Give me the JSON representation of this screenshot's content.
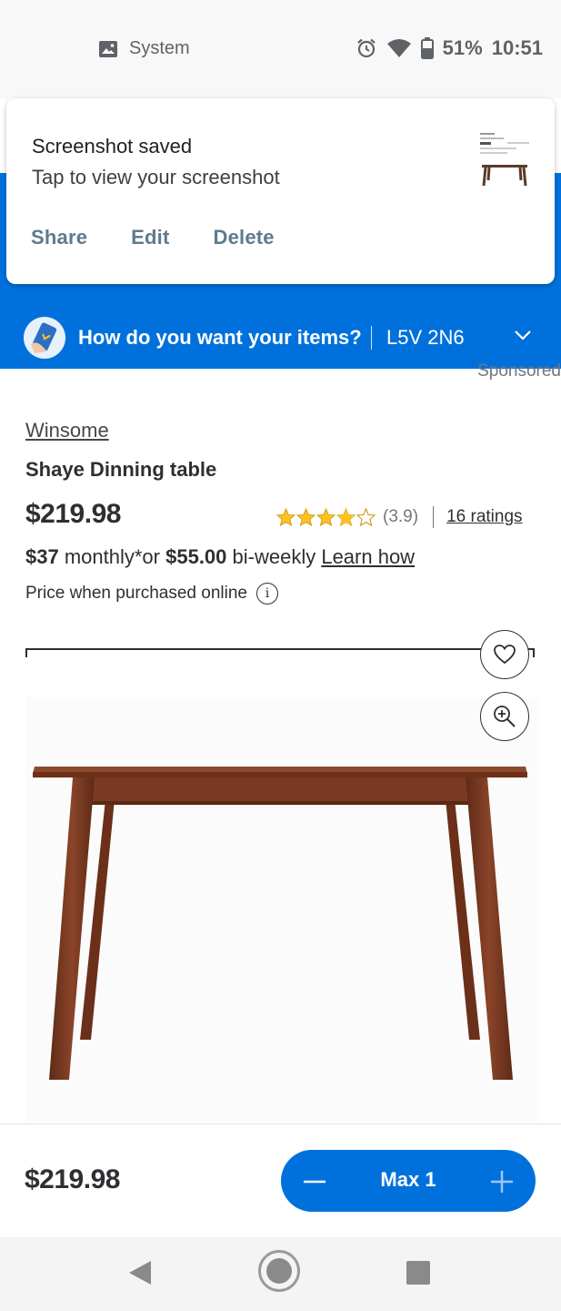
{
  "status_bar": {
    "app_label": "System",
    "battery": "51%",
    "time": "10:51",
    "icons": [
      "image-icon",
      "alarm-icon",
      "wifi-icon",
      "battery-icon"
    ]
  },
  "notification": {
    "title": "Screenshot saved",
    "subtitle": "Tap to view your screenshot",
    "actions": [
      "Share",
      "Edit",
      "Delete"
    ]
  },
  "delivery_bar": {
    "prompt": "How do you want your items?",
    "postal_code": "L5V 2N6"
  },
  "product": {
    "sponsored": "Sponsored",
    "brand": "Winsome",
    "name": "Shaye Dinning table",
    "price": "$219.98",
    "rating_value": "(3.9)",
    "rating_stars": 3.9,
    "ratings_count": "16 ratings",
    "monthly_amount": "$37",
    "monthly_text": " monthly*or ",
    "biweekly_amount": "$55.00",
    "biweekly_text": " bi-weekly ",
    "learn_how": "Learn how",
    "price_note": "Price when purchased online"
  },
  "bottom_bar": {
    "price": "$219.98",
    "quantity_label": "Max 1"
  },
  "colors": {
    "brand_blue": "#0071dc",
    "star_gold": "#ffc220",
    "wood": "#7a3a22"
  }
}
